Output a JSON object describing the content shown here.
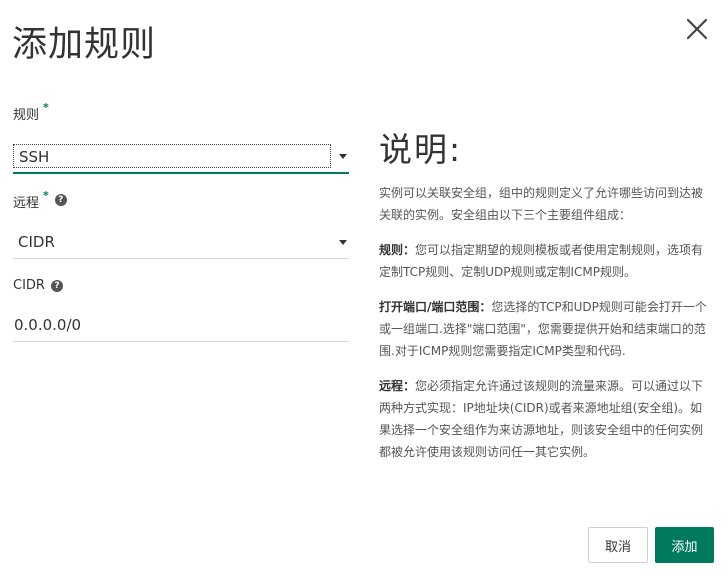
{
  "dialog": {
    "title": "添加规则"
  },
  "form": {
    "rule": {
      "label": "规则",
      "required_mark": "*",
      "value": "SSH"
    },
    "remote": {
      "label": "远程",
      "required_mark": "*",
      "help": "?",
      "value": "CIDR"
    },
    "cidr": {
      "label": "CIDR",
      "help": "?",
      "value": "0.0.0.0/0"
    }
  },
  "description": {
    "heading": "说明:",
    "intro": "实例可以关联安全组，组中的规则定义了允许哪些访问到达被关联的实例。安全组由以下三个主要组件组成：",
    "rule_title": "规则：",
    "rule_text": "您可以指定期望的规则模板或者使用定制规则，选项有定制TCP规则、定制UDP规则或定制ICMP规则。",
    "port_title": "打开端口/端口范围：",
    "port_text": "您选择的TCP和UDP规则可能会打开一个或一组端口.选择\"端口范围\"，您需要提供开始和结束端口的范围.对于ICMP规则您需要指定ICMP类型和代码.",
    "remote_title": "远程：",
    "remote_text": "您必须指定允许通过该规则的流量来源。可以通过以下两种方式实现：IP地址块(CIDR)或者来源地址组(安全组)。如果选择一个安全组作为来访源地址，则该安全组中的任何实例都被允许使用该规则访问任一其它实例。"
  },
  "footer": {
    "cancel_label": "取消",
    "add_label": "添加"
  },
  "colors": {
    "accent": "#007a5e",
    "text": "#333333",
    "muted": "#555555",
    "border": "#d6d6d6"
  },
  "icons": {
    "close": "close-icon",
    "help": "help-circle-icon",
    "dropdown": "chevron-down-icon"
  }
}
